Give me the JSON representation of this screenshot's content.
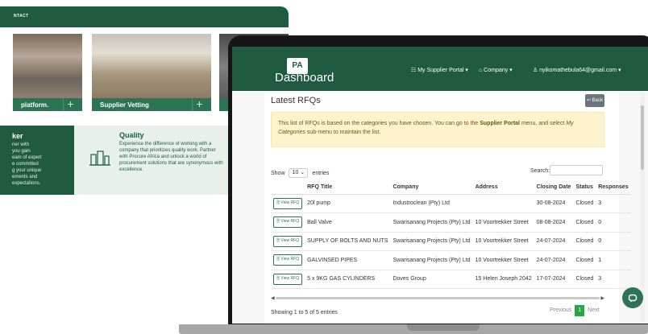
{
  "background_site": {
    "nav_label": "NTACT",
    "cards": [
      {
        "label": "platform.",
        "plus": "+"
      },
      {
        "label": "Supplier Vetting",
        "plus": "+"
      },
      {
        "label": "",
        "plus": ""
      }
    ],
    "left_box": {
      "title": "ker",
      "text": "ner with\nyou gain\neam of expert\ne committed\ng your unique\nements and\nexpectations."
    },
    "quality_box": {
      "title": "Quality",
      "text": "Experience the difference of working with a company that prioritizes quality work. Partner with Procure Africa and unlock a world of procurement solutions that are synonymous with excellence."
    }
  },
  "app": {
    "logo_text": "PA",
    "title": "Dashboard",
    "nav": {
      "portal": "☷ My Supplier Portal ▾",
      "company": "⌂ Company ▾",
      "user": "♙ nyikomathebula64@gmail.com ▾"
    }
  },
  "rfqs": {
    "heading": "Latest RFQs",
    "back_label": "↩ Back",
    "alert_pre": "This list of RFQs is based on the categories you have chosen. You can go to the ",
    "alert_bold": "Supplier Portal",
    "alert_mid": " menu, and select ",
    "alert_italic": "My Categories",
    "alert_post": " sub-menu to maintain the list.",
    "show_label": "Show",
    "show_value": "10 ⌄",
    "entries_label": "entries",
    "search_label": "Search:",
    "columns": [
      "",
      "RFQ Title",
      "Company",
      "Address",
      "Closing Date",
      "Status",
      "Responses"
    ],
    "view_label": "🗎 View RFQ",
    "rows": [
      {
        "title": "20l pump",
        "company": "Industroclean (Pty) Ltd",
        "address": "",
        "date": "30-08-2024",
        "status": "Closed",
        "responses": "3"
      },
      {
        "title": "Ball Valve",
        "company": "Swarisanang Projects (Pty) Ltd",
        "address": "10 Voortrekker Street",
        "date": "08-08-2024",
        "status": "Closed",
        "responses": "0"
      },
      {
        "title": "SUPPLY OF BOLTS AND NUTS",
        "company": "Swarisanang Projects (Pty) Ltd",
        "address": "10 Voortrekker Street",
        "date": "24-07-2024",
        "status": "Closed",
        "responses": "0"
      },
      {
        "title": "GALVINSED PIPES",
        "company": "Swarisanang Projects (Pty) Ltd",
        "address": "10 Voortrekker Street",
        "date": "24-07-2024",
        "status": "Closed",
        "responses": "1"
      },
      {
        "title": "5 x 9KG GAS CYLINDERS",
        "company": "Doves Group",
        "address": "15 Helen Joseph 2042",
        "date": "17-07-2024",
        "status": "Closed",
        "responses": "3"
      }
    ],
    "info": "Showing 1 to 5 of 5 entries",
    "pager": {
      "prev": "Previous",
      "page": "1",
      "next": "Next"
    }
  },
  "chat_icon": "chat-bubble-icon"
}
